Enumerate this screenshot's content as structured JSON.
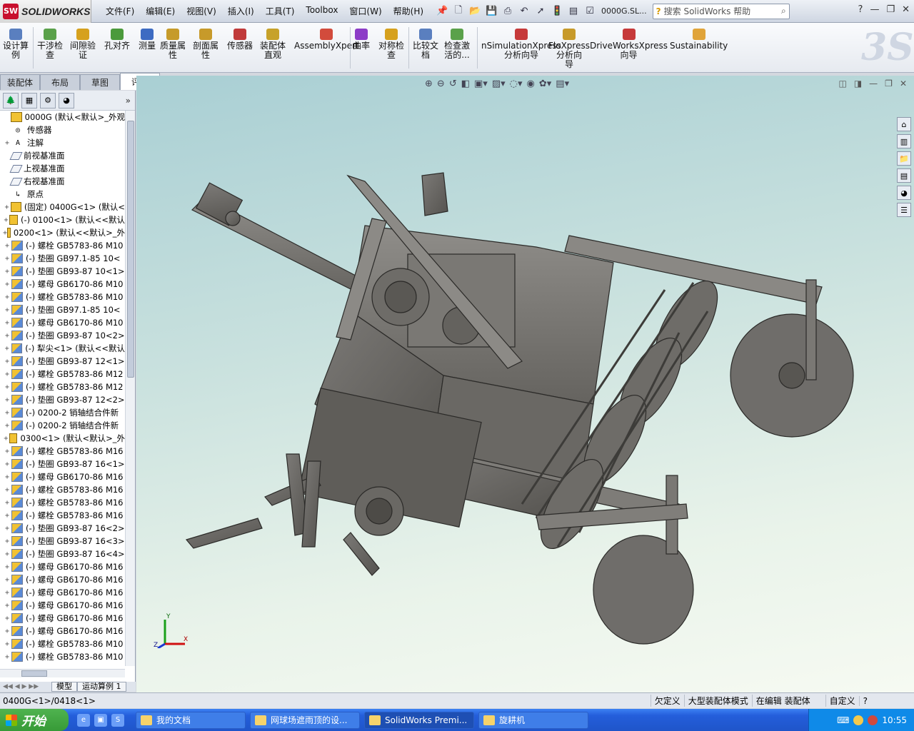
{
  "app": {
    "logo_text": "SOLIDWORKS",
    "logo_badge": "SW"
  },
  "menu": [
    "文件(F)",
    "编辑(E)",
    "视图(V)",
    "插入(I)",
    "工具(T)",
    "Toolbox",
    "窗口(W)",
    "帮助(H)"
  ],
  "title": {
    "document": "0000G.SL..."
  },
  "search": {
    "placeholder": "搜索 SolidWorks 帮助"
  },
  "commands": [
    {
      "label": "设计算\n例"
    },
    {
      "label": "干涉检\n查"
    },
    {
      "label": "间隙验\n证"
    },
    {
      "label": "孔对齐"
    },
    {
      "label": "测量"
    },
    {
      "label": "质量属\n性"
    },
    {
      "label": "剖面属\n性"
    },
    {
      "label": "传感器"
    },
    {
      "label": "装配体\n直观"
    },
    {
      "label": "AssemblyXpert"
    },
    {
      "label": "曲率"
    },
    {
      "label": "对称检\n查"
    },
    {
      "label": "比较文\n档"
    },
    {
      "label": "检查激\n活的..."
    },
    {
      "label": "nSimulationXpress\n分析向导"
    },
    {
      "label": "FloXpress\n分析向\n导"
    },
    {
      "label": "DriveWorksXpress\n向导"
    },
    {
      "label": "Sustainability"
    }
  ],
  "tabs": [
    {
      "label": "装配体",
      "active": false
    },
    {
      "label": "布局",
      "active": false
    },
    {
      "label": "草图",
      "active": false
    },
    {
      "label": "评估",
      "active": true
    }
  ],
  "tree": [
    {
      "kind": "asm",
      "text": "0000G  (默认<默认>_外观",
      "expand": ""
    },
    {
      "kind": "sensor",
      "text": "传感器",
      "expand": ""
    },
    {
      "kind": "note",
      "text": "注解",
      "expand": "+"
    },
    {
      "kind": "plane",
      "text": "前视基准面",
      "expand": ""
    },
    {
      "kind": "plane",
      "text": "上视基准面",
      "expand": ""
    },
    {
      "kind": "plane",
      "text": "右视基准面",
      "expand": ""
    },
    {
      "kind": "origin",
      "text": "原点",
      "expand": ""
    },
    {
      "kind": "asm",
      "text": "(固定) 0400G<1> (默认<",
      "expand": "+"
    },
    {
      "kind": "asm",
      "text": "(-) 0100<1> (默认<<默认",
      "expand": "+"
    },
    {
      "kind": "asm",
      "text": "0200<1> (默认<<默认>_外",
      "expand": "+"
    },
    {
      "kind": "part",
      "text": "(-) 螺栓 GB5783-86 M10",
      "expand": "+"
    },
    {
      "kind": "part",
      "text": "(-) 垫圈 GB97.1-85 10<",
      "expand": "+"
    },
    {
      "kind": "part",
      "text": "(-) 垫圈 GB93-87 10<1>",
      "expand": "+"
    },
    {
      "kind": "part",
      "text": "(-) 螺母 GB6170-86 M10",
      "expand": "+"
    },
    {
      "kind": "part",
      "text": "(-) 螺栓 GB5783-86 M10",
      "expand": "+"
    },
    {
      "kind": "part",
      "text": "(-) 垫圈 GB97.1-85 10<",
      "expand": "+"
    },
    {
      "kind": "part",
      "text": "(-) 螺母 GB6170-86 M10",
      "expand": "+"
    },
    {
      "kind": "part",
      "text": "(-) 垫圈 GB93-87 10<2>",
      "expand": "+"
    },
    {
      "kind": "part",
      "text": "(-) 犁尖<1> (默认<<默认",
      "expand": "+"
    },
    {
      "kind": "part",
      "text": "(-) 垫圈 GB93-87 12<1>",
      "expand": "+"
    },
    {
      "kind": "part",
      "text": "(-) 螺栓 GB5783-86 M12",
      "expand": "+"
    },
    {
      "kind": "part",
      "text": "(-) 螺栓 GB5783-86 M12",
      "expand": "+"
    },
    {
      "kind": "part",
      "text": "(-) 垫圈 GB93-87 12<2>",
      "expand": "+"
    },
    {
      "kind": "part",
      "text": "(-) 0200-2 销轴结合件新",
      "expand": "+"
    },
    {
      "kind": "part",
      "text": "(-) 0200-2 销轴结合件新",
      "expand": "+"
    },
    {
      "kind": "asm",
      "text": "0300<1> (默认<默认>_外",
      "expand": "+"
    },
    {
      "kind": "part",
      "text": "(-) 螺栓 GB5783-86 M16",
      "expand": "+"
    },
    {
      "kind": "part",
      "text": "(-) 垫圈 GB93-87 16<1>",
      "expand": "+"
    },
    {
      "kind": "part",
      "text": "(-) 螺母 GB6170-86 M16",
      "expand": "+"
    },
    {
      "kind": "part",
      "text": "(-) 螺栓 GB5783-86 M16",
      "expand": "+"
    },
    {
      "kind": "part",
      "text": "(-) 螺栓 GB5783-86 M16",
      "expand": "+"
    },
    {
      "kind": "part",
      "text": "(-) 螺栓 GB5783-86 M16",
      "expand": "+"
    },
    {
      "kind": "part",
      "text": "(-) 垫圈 GB93-87 16<2>",
      "expand": "+"
    },
    {
      "kind": "part",
      "text": "(-) 垫圈 GB93-87 16<3>",
      "expand": "+"
    },
    {
      "kind": "part",
      "text": "(-) 垫圈 GB93-87 16<4>",
      "expand": "+"
    },
    {
      "kind": "part",
      "text": "(-) 螺母 GB6170-86 M16",
      "expand": "+"
    },
    {
      "kind": "part",
      "text": "(-) 螺母 GB6170-86 M16",
      "expand": "+"
    },
    {
      "kind": "part",
      "text": "(-) 螺母 GB6170-86 M16",
      "expand": "+"
    },
    {
      "kind": "part",
      "text": "(-) 螺母 GB6170-86 M16",
      "expand": "+"
    },
    {
      "kind": "part",
      "text": "(-) 螺母 GB6170-86 M16",
      "expand": "+"
    },
    {
      "kind": "part",
      "text": "(-) 螺母 GB6170-86 M16",
      "expand": "+"
    },
    {
      "kind": "part",
      "text": "(-) 螺栓 GB5783-86 M10",
      "expand": "+"
    },
    {
      "kind": "part",
      "text": "(-) 螺栓 GB5783-86 M10",
      "expand": "+"
    }
  ],
  "bottom_tabs": {
    "model": "模型",
    "motion": "运动算例 1"
  },
  "triad": {
    "x": "X",
    "y": "Y",
    "z": "Z"
  },
  "status": {
    "left": "0400G<1>/0418<1>",
    "underdefined": "欠定义",
    "large_mode": "大型装配体模式",
    "editing": "在编辑 装配体",
    "custom": "自定义"
  },
  "taskbar": {
    "start": "开始",
    "buttons": [
      {
        "label": "我的文档",
        "active": false
      },
      {
        "label": "网球场遮雨顶的设...",
        "active": false
      },
      {
        "label": "SolidWorks Premi...",
        "active": true
      },
      {
        "label": "旋耕机",
        "active": false
      }
    ],
    "clock": "10:55"
  },
  "colors": {
    "accent": "#c8102e",
    "viewport_top": "#a9cfd4",
    "viewport_bottom": "#f6faf2",
    "model": "#6f6d6a"
  }
}
